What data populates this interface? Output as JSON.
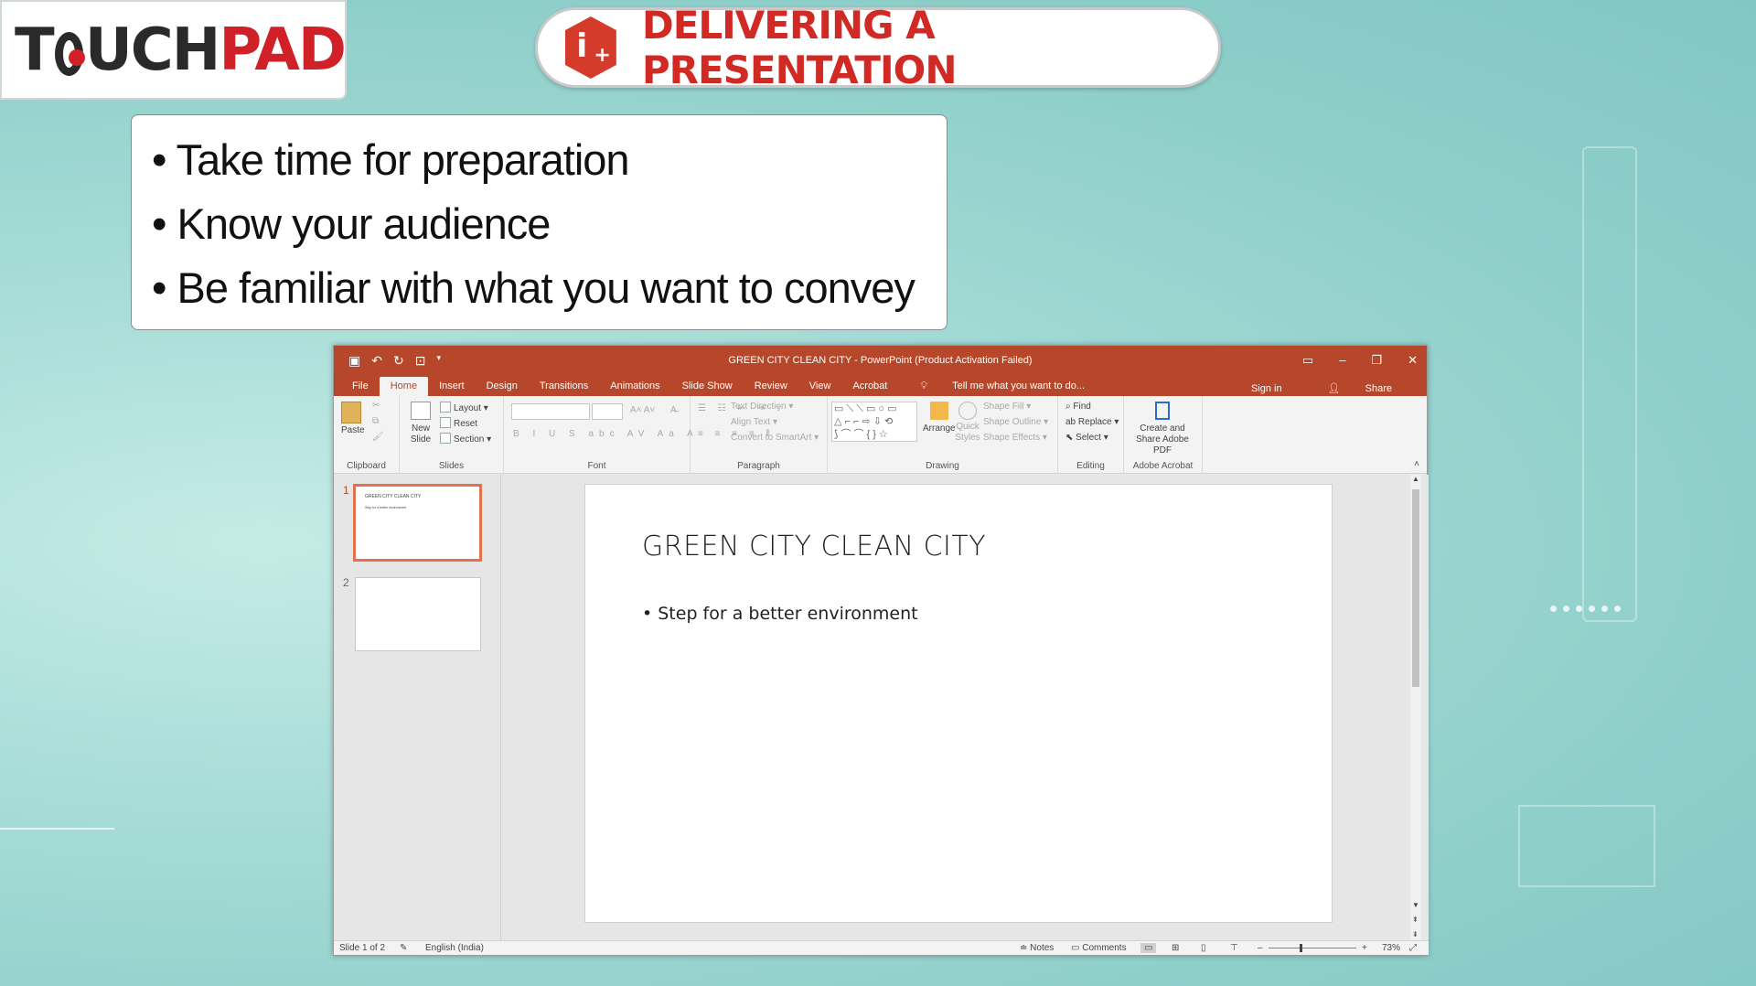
{
  "logo": {
    "part1": "T",
    "part2": "UCH",
    "part3": "PAD"
  },
  "header": {
    "title": "DELIVERING A PRESENTATION",
    "icon": "info-plus-hexagon-icon",
    "icon_letter": "i",
    "icon_plus": "+"
  },
  "bullets": [
    "Take time for preparation",
    "Know your audience",
    "Be familiar with what you want to convey"
  ],
  "ppt": {
    "window_title": "GREEN CITY CLEAN CITY - PowerPoint (Product Activation Failed)",
    "tabs": [
      "File",
      "Home",
      "Insert",
      "Design",
      "Transitions",
      "Animations",
      "Slide Show",
      "Review",
      "View",
      "Acrobat"
    ],
    "active_tab": "Home",
    "tell_me": "Tell me what you want to do...",
    "sign_in": "Sign in",
    "share": "Share",
    "ribbon": {
      "clipboard": {
        "label": "Clipboard",
        "paste": "Paste"
      },
      "slides": {
        "label": "Slides",
        "new_slide": "New Slide",
        "layout": "Layout",
        "reset": "Reset",
        "section": "Section"
      },
      "font": {
        "label": "Font"
      },
      "paragraph": {
        "label": "Paragraph",
        "text_direction": "Text Direction",
        "align_text": "Align Text",
        "convert": "Convert to SmartArt"
      },
      "drawing": {
        "label": "Drawing",
        "arrange": "Arrange",
        "quick_styles": "Quick Styles",
        "shape_fill": "Shape Fill",
        "shape_outline": "Shape Outline",
        "shape_effects": "Shape Effects"
      },
      "editing": {
        "label": "Editing",
        "find": "Find",
        "replace": "Replace",
        "select": "Select"
      },
      "acrobat": {
        "label": "Adobe Acrobat",
        "create": "Create and Share Adobe PDF"
      }
    },
    "thumbnails": [
      {
        "num": "1",
        "title": "GREEN CITY CLEAN CITY",
        "bullet": "Step for a better environment",
        "selected": true
      },
      {
        "num": "2",
        "title": "",
        "bullet": "",
        "selected": false
      }
    ],
    "slide": {
      "title": "GREEN CITY CLEAN CITY",
      "bullet": "Step for a better environment"
    },
    "status": {
      "slide_count": "Slide 1 of 2",
      "language": "English (India)",
      "notes": "Notes",
      "comments": "Comments",
      "zoom": "73%"
    }
  },
  "colors": {
    "accent": "#b7472a",
    "brand_red": "#d12a25"
  }
}
